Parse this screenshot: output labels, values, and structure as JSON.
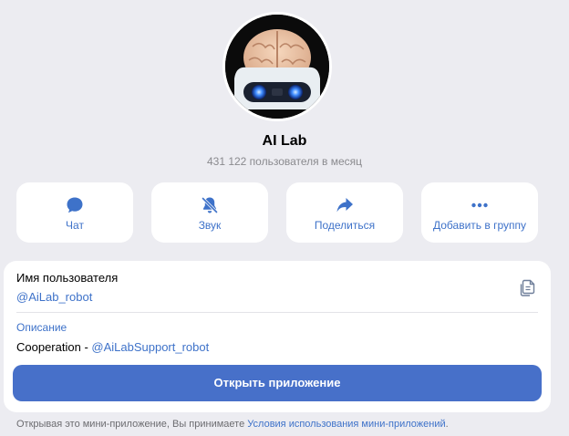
{
  "profile": {
    "name": "AI Lab",
    "subtitle": "431 122 пользователя в месяц",
    "avatar_icon": "brain-robot-avatar"
  },
  "actions": [
    {
      "label": "Чат",
      "icon": "chat-bubble-icon"
    },
    {
      "label": "Звук",
      "icon": "bell-muted-icon"
    },
    {
      "label": "Поделиться",
      "icon": "share-arrow-icon"
    },
    {
      "label": "Добавить в группу",
      "icon": "more-dots-icon"
    }
  ],
  "info": {
    "username_label": "Имя пользователя",
    "username_value": "@AiLab_robot",
    "description_label": "Описание",
    "description_prefix": "Cooperation - ",
    "description_link": "@AiLabSupport_robot",
    "copy_icon": "copy-icon"
  },
  "open_button": "Открыть приложение",
  "footer": {
    "text": "Открывая это мини-приложение, Вы принимаете ",
    "link": "Условия использования мини-приложений",
    "suffix": "."
  },
  "colors": {
    "accent": "#3e72c9",
    "button": "#4770c9",
    "background": "#ececf1",
    "card": "#ffffff",
    "muted": "#8a8a8e"
  }
}
